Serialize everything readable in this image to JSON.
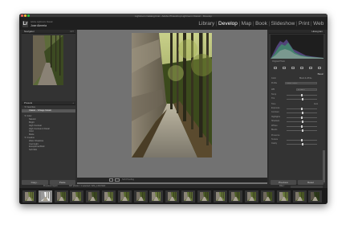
{
  "window": {
    "title": "Lightroom Catalog.lrcat - Adobe Photoshop Lightroom Classic - Develop"
  },
  "identity": {
    "logo": "Lr",
    "subtitle": "Adobe Lightroom Classic",
    "owner": "Jose Almeria"
  },
  "modules": [
    "Library",
    "Develop",
    "Map",
    "Book",
    "Slideshow",
    "Print",
    "Web"
  ],
  "active_module": "Develop",
  "left_panel": {
    "navigator_label": "Navigator",
    "navigator_fit": "FIT",
    "presets_label": "Presets",
    "preset_items": [
      {
        "label": "▼ Favorites",
        "indent": 1
      },
      {
        "label": "Classic - Vintage Instant",
        "indent": 3,
        "selected": true
      },
      {
        "label": "",
        "indent": 0
      },
      {
        "label": "▼ Color",
        "indent": 1
      },
      {
        "label": "Natural",
        "indent": 3
      },
      {
        "label": "Bright",
        "indent": 3
      },
      {
        "label": "High Contrast",
        "indent": 3
      },
      {
        "label": "High Contrast & Detail",
        "indent": 3
      },
      {
        "label": "Vivid",
        "indent": 3
      },
      {
        "label": "Matte",
        "indent": 3
      },
      {
        "label": "▼ Creative",
        "indent": 1
      },
      {
        "label": "Warm Shadows",
        "indent": 3
      },
      {
        "label": "Cool Light",
        "indent": 3
      },
      {
        "label": "Exceptional Bold",
        "indent": 3
      },
      {
        "label": "Soft Mist",
        "indent": 3
      }
    ],
    "copy_button": "Copy...",
    "paste_button": "Paste"
  },
  "toolbar": {
    "soft_proofing": "Soft Proofing"
  },
  "right_panel": {
    "histogram_label": "Histogram",
    "original_photo": "Original Photo",
    "basic_label": "Basic",
    "treatment_color": "Color",
    "treatment_bw": "Black & White",
    "profile_label": "Profile",
    "profile_value": "Adobe Color",
    "wb_label": "WB",
    "wb_value": "As Shot",
    "temp_label": "Temp",
    "tint_label": "Tint",
    "tone_label": "Tone",
    "auto_label": "Auto",
    "exposure_label": "Exposure",
    "contrast_label": "Contrast",
    "highlights_label": "Highlights",
    "shadows_label": "Shadows",
    "whites_label": "Whites",
    "blacks_label": "Blacks",
    "presence_label": "Presence",
    "texture_label": "Texture",
    "clarity_label": "Clarity",
    "previous_button": "Previous",
    "reset_button": "Reset"
  },
  "filmstrip_bar": {
    "source": "Previous Import",
    "count": "307 photos / 1 selected / IMG_1319.NEF",
    "filter_label": "Filter :"
  },
  "colors": {
    "panel": "#333333",
    "center": "#727272",
    "filmstrip": "#1a1a1a",
    "accent": "#ffffff"
  }
}
